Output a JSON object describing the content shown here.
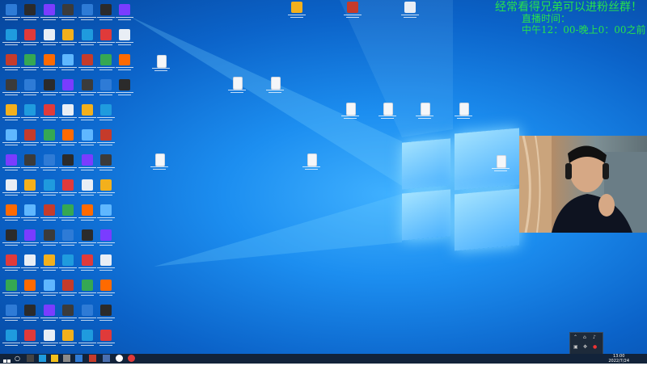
{
  "overlay": {
    "line1": "经常看得兄弟可以进粉丝群！",
    "line2": "直播时间：",
    "line3": "中午12：00-晚上0：00之前",
    "color": "#27e04d"
  },
  "desktop": {
    "wallpaper": "windows-10-hero-blue",
    "icon_colors": [
      "#2e7bd6",
      "#e9eef5",
      "#c53b2b",
      "#2b2b2b",
      "#f3b01c",
      "#35a853",
      "#7a3cff",
      "#1f9bde",
      "#ff6a00",
      "#3b3b3b",
      "#e03a3a",
      "#5fb7ff"
    ]
  },
  "webcam": {
    "subject": "streamer-with-headphones"
  },
  "taskbar": {
    "start_icon": "windows-start-icon",
    "clock_time": "13:00",
    "clock_date": "2022/7/24"
  }
}
